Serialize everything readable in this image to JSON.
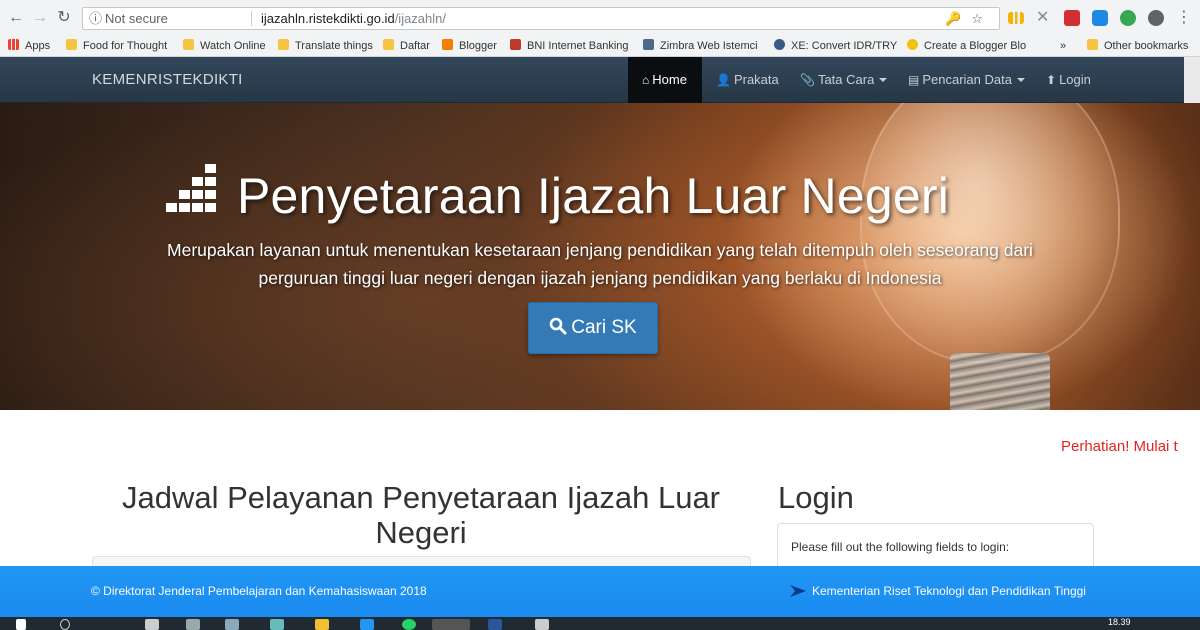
{
  "browser": {
    "security_label": "Not secure",
    "url_host": "ijazahln.ristekdikti.go.id",
    "url_path": "/ijazahln/",
    "bookmarks": [
      {
        "label": "Apps",
        "color": "#ea4335"
      },
      {
        "label": "Food for Thought",
        "color": "#f6c343"
      },
      {
        "label": "Watch Online",
        "color": "#f6c343"
      },
      {
        "label": "Translate things",
        "color": "#f6c343"
      },
      {
        "label": "Daftar",
        "color": "#f6c343"
      },
      {
        "label": "Blogger",
        "color": "#f57d00"
      },
      {
        "label": "BNI Internet Banking",
        "color": "#c0392b"
      },
      {
        "label": "Zimbra Web Istemci",
        "color": "#4a6a8a"
      },
      {
        "label": "XE: Convert IDR/TRY",
        "color": "#3a5a88"
      },
      {
        "label": "Create a Blogger Blo",
        "color": "#f1c40f"
      },
      {
        "label": "»",
        "color": ""
      },
      {
        "label": "Other bookmarks",
        "color": "#f6c343"
      }
    ]
  },
  "navbar": {
    "brand": "KEMENRISTEKDIKTI",
    "items": [
      {
        "label": "Home",
        "icon": "home-icon"
      },
      {
        "label": "Prakata",
        "icon": "user-icon"
      },
      {
        "label": "Tata Cara",
        "icon": "paperclip-icon"
      },
      {
        "label": "Pencarian Data",
        "icon": "list-icon"
      },
      {
        "label": "Login",
        "icon": "upload-icon"
      }
    ]
  },
  "hero": {
    "title": "Penyetaraan Ijazah Luar Negeri",
    "subtitle_line1": "Merupakan layanan untuk menentukan kesetaraan jenjang pendidikan yang telah ditempuh oleh seseorang dari",
    "subtitle_line2": "perguruan tinggi luar negeri dengan ijazah jenjang pendidikan yang berlaku di Indonesia",
    "button_label": "Cari SK"
  },
  "announcement": "Perhatian! Mulai t",
  "schedule": {
    "title_line1": "Jadwal Pelayanan Penyetaraan Ijazah Luar",
    "title_line2": "Negeri"
  },
  "login": {
    "title": "Login",
    "help_text": "Please fill out the following fields to login:"
  },
  "footer": {
    "copyright": "© Direktorat Jenderal Pembelajaran dan Kemahasiswaan 2018",
    "ministry": "Kementerian Riset Teknologi dan Pendidikan Tinggi"
  },
  "taskbar": {
    "clock": "18.39"
  },
  "colors": {
    "navbar": "#2c3e50",
    "button": "#337ab7",
    "footer": "#1e90ff",
    "alert": "#e32323"
  }
}
